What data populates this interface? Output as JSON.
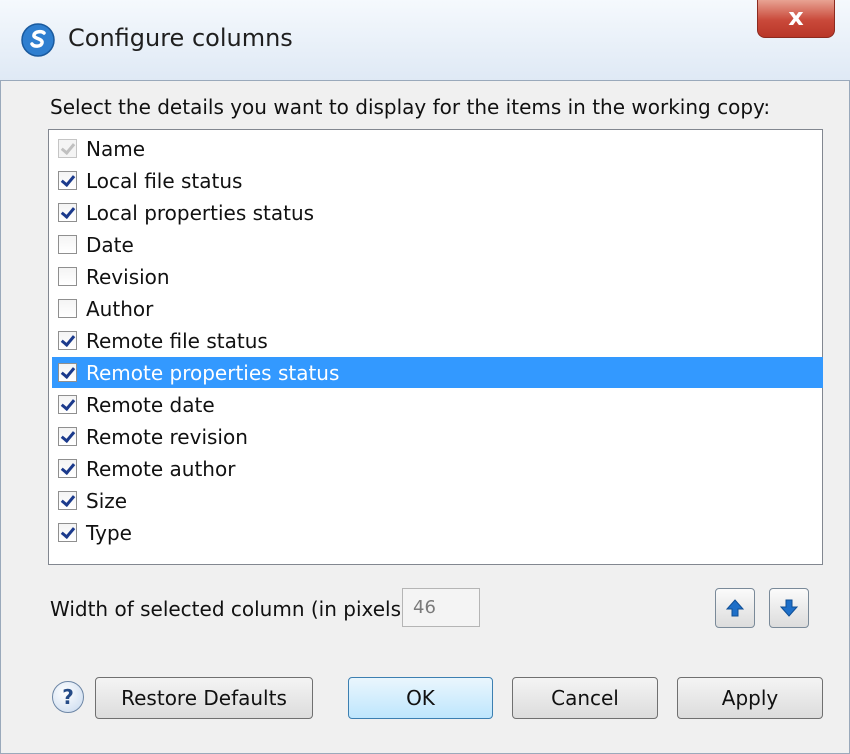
{
  "window": {
    "title": "Configure columns",
    "close_glyph": "x"
  },
  "instruction": "Select the details you want to display for the items in the working copy:",
  "columns": [
    {
      "label": "Name",
      "checked": true,
      "disabled": true
    },
    {
      "label": "Local file status",
      "checked": true
    },
    {
      "label": "Local properties status",
      "checked": true
    },
    {
      "label": "Date",
      "checked": false
    },
    {
      "label": "Revision",
      "checked": false
    },
    {
      "label": "Author",
      "checked": false
    },
    {
      "label": "Remote file status",
      "checked": true
    },
    {
      "label": "Remote properties status",
      "checked": true,
      "selected": true
    },
    {
      "label": "Remote date",
      "checked": true
    },
    {
      "label": "Remote revision",
      "checked": true
    },
    {
      "label": "Remote author",
      "checked": true
    },
    {
      "label": "Size",
      "checked": true
    },
    {
      "label": "Type",
      "checked": true
    }
  ],
  "width_label": "Width of selected column (in pixels):",
  "width_value": "46",
  "buttons": {
    "help": "?",
    "restore": "Restore Defaults",
    "ok": "OK",
    "cancel": "Cancel",
    "apply": "Apply"
  },
  "colors": {
    "selection": "#3399ff",
    "accent": "#1e6fc8"
  },
  "icons": {
    "app": "app-logo-icon",
    "up": "arrow-up-icon",
    "down": "arrow-down-icon",
    "help": "help-icon"
  }
}
